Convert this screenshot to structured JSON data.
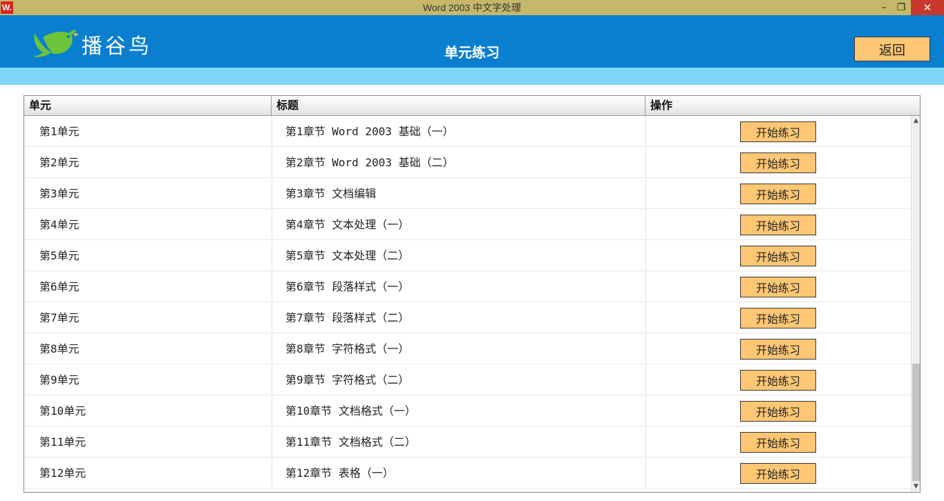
{
  "window": {
    "icon_label": "W.",
    "title": "Word 2003 中文字处理",
    "minimize": "–",
    "restore": "❐",
    "close": "✕"
  },
  "header": {
    "logo_text": "播谷鸟",
    "page_title": "单元练习",
    "back_label": "返回",
    "colors": {
      "header_bg": "#0a7fd0",
      "subbar_bg": "#7fd6f7",
      "button_bg": "#ffc774",
      "logo_green": "#6cc43a"
    }
  },
  "table": {
    "columns": [
      "单元",
      "标题",
      "操作"
    ],
    "rows": [
      {
        "unit": "第1单元",
        "title": "第1章节 Word 2003 基础（一）",
        "action": "开始练习"
      },
      {
        "unit": "第2单元",
        "title": "第2章节 Word 2003 基础（二）",
        "action": "开始练习"
      },
      {
        "unit": "第3单元",
        "title": "第3章节 文档编辑",
        "action": "开始练习"
      },
      {
        "unit": "第4单元",
        "title": "第4章节 文本处理（一）",
        "action": "开始练习"
      },
      {
        "unit": "第5单元",
        "title": "第5章节 文本处理（二）",
        "action": "开始练习"
      },
      {
        "unit": "第6单元",
        "title": "第6章节 段落样式（一）",
        "action": "开始练习"
      },
      {
        "unit": "第7单元",
        "title": "第7章节 段落样式（二）",
        "action": "开始练习"
      },
      {
        "unit": "第8单元",
        "title": "第8章节 字符格式（一）",
        "action": "开始练习"
      },
      {
        "unit": "第9单元",
        "title": "第9章节 字符格式（二）",
        "action": "开始练习"
      },
      {
        "unit": "第10单元",
        "title": "第10章节 文档格式（一）",
        "action": "开始练习"
      },
      {
        "unit": "第11单元",
        "title": "第11章节 文档格式（二）",
        "action": "开始练习"
      },
      {
        "unit": "第12单元",
        "title": "第12章节 表格（一）",
        "action": "开始练习"
      }
    ]
  },
  "scrollbar": {
    "up": "▲",
    "down": "▼"
  }
}
